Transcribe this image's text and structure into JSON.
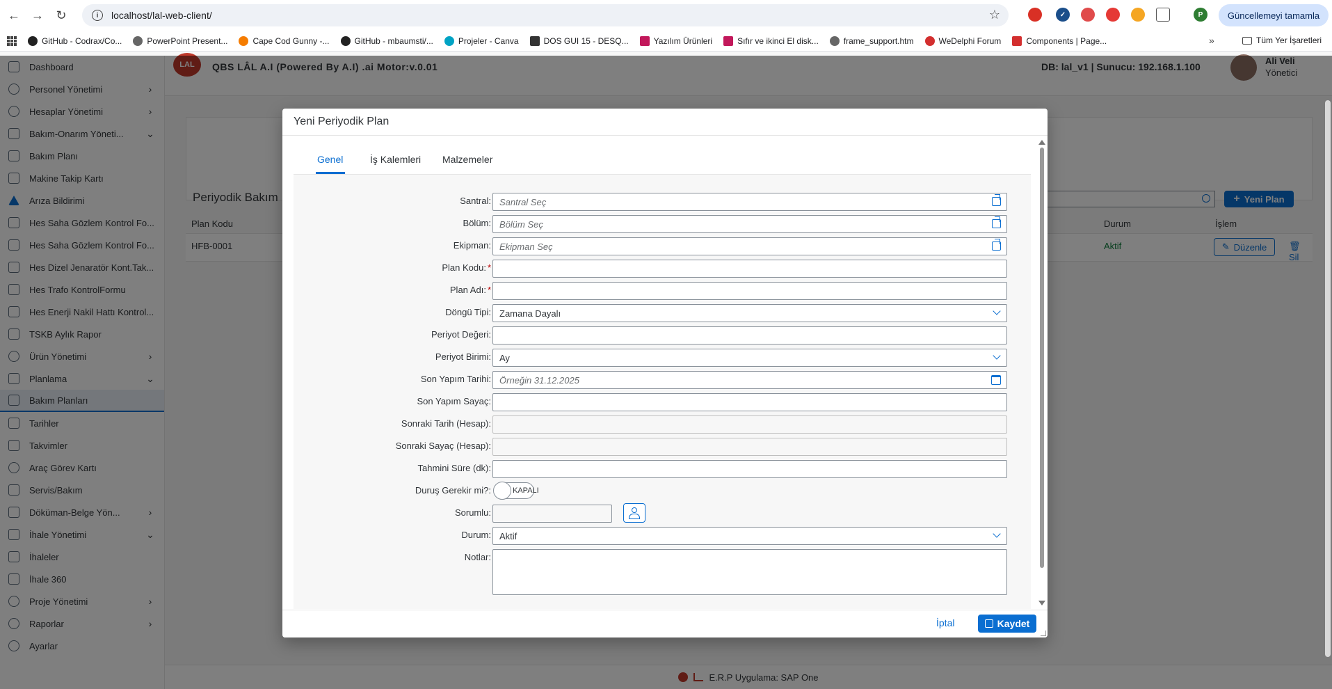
{
  "browser": {
    "url": "localhost/lal-web-client/",
    "update_button": "Güncellemeyi tamamla",
    "bookmarks": [
      "GitHub - Codrax/Co...",
      "PowerPoint Present...",
      "Cape Cod Gunny -...",
      "GitHub - mbaumsti/...",
      "Projeler - Canva",
      "DOS GUI 15 - DESQ...",
      "Yazılım Ürünleri",
      "Sıfır ve ikinci El disk...",
      "frame_support.htm",
      "WeDelphi Forum",
      "Components | Page..."
    ],
    "all_bookmarks": "Tüm Yer İşaretleri"
  },
  "app": {
    "title": "QBS LÂL A.I (Powered By A.I) .ai Motor:v.0.01",
    "logo_text": "LAL",
    "db_info": "DB: lal_v1 | Sunucu: 192.168.1.100",
    "user_name": "Ali Veli",
    "user_role": "Yönetici",
    "footer": "E.R.P Uygulama: SAP One"
  },
  "sidebar": {
    "items": [
      {
        "label": "Dashboard"
      },
      {
        "label": "Personel Yönetimi"
      },
      {
        "label": "Hesaplar Yönetimi"
      },
      {
        "label": "Bakım-Onarım Yöneti..."
      },
      {
        "label": "Bakım Planı"
      },
      {
        "label": "Makine Takip Kartı"
      },
      {
        "label": "Arıza Bildirimi"
      },
      {
        "label": "Hes Saha Gözlem Kontrol Fo..."
      },
      {
        "label": "Hes Saha Gözlem Kontrol Fo..."
      },
      {
        "label": "Hes Dizel Jenaratör Kont.Tak..."
      },
      {
        "label": "Hes Trafo KontrolFormu"
      },
      {
        "label": "Hes Enerji Nakil Hattı Kontrol..."
      },
      {
        "label": "TSKB Aylık Rapor"
      },
      {
        "label": "Ürün Yönetimi"
      },
      {
        "label": "Planlama"
      },
      {
        "label": "Bakım Planları"
      },
      {
        "label": "Tarihler"
      },
      {
        "label": "Takvimler"
      },
      {
        "label": "Araç Görev Kartı"
      },
      {
        "label": "Servis/Bakım"
      },
      {
        "label": "Döküman-Belge Yön..."
      },
      {
        "label": "İhale Yönetimi"
      },
      {
        "label": "İhaleler"
      },
      {
        "label": "İhale 360"
      },
      {
        "label": "Proje Yönetimi"
      },
      {
        "label": "Raporlar"
      },
      {
        "label": "Ayarlar"
      }
    ]
  },
  "page": {
    "title": "Periyodik Bakım",
    "new_button": "Yeni Plan",
    "columns": {
      "code": "Plan Kodu",
      "status": "Durum",
      "action": "İşlem"
    },
    "row": {
      "code": "HFB-0001",
      "status": "Aktif",
      "edit": "Düzenle",
      "delete": "Sil"
    }
  },
  "dialog": {
    "title": "Yeni Periyodik Plan",
    "tabs": [
      "Genel",
      "İş Kalemleri",
      "Malzemeler"
    ],
    "fields": {
      "santral": {
        "label": "Santral:",
        "placeholder": "Santral Seç"
      },
      "bolum": {
        "label": "Bölüm:",
        "placeholder": "Bölüm Seç"
      },
      "ekipman": {
        "label": "Ekipman:",
        "placeholder": "Ekipman Seç"
      },
      "plan_kodu": {
        "label": "Plan Kodu:",
        "value": ""
      },
      "plan_adi": {
        "label": "Plan Adı:",
        "value": ""
      },
      "dongu_tipi": {
        "label": "Döngü Tipi:",
        "value": "Zamana Dayalı"
      },
      "periyot_degeri": {
        "label": "Periyot Değeri:",
        "value": ""
      },
      "periyot_birimi": {
        "label": "Periyot Birimi:",
        "value": "Ay"
      },
      "son_yapim_tarihi": {
        "label": "Son Yapım Tarihi:",
        "placeholder": "Örneğin 31.12.2025"
      },
      "son_yapim_sayac": {
        "label": "Son Yapım Sayaç:",
        "value": ""
      },
      "sonraki_tarih": {
        "label": "Sonraki Tarih (Hesap):",
        "value": ""
      },
      "sonraki_sayac": {
        "label": "Sonraki Sayaç (Hesap):",
        "value": ""
      },
      "tahmini_sure": {
        "label": "Tahmini Süre (dk):",
        "value": ""
      },
      "durus": {
        "label": "Duruş Gerekir mi?:",
        "switch_text": "KAPALI"
      },
      "sorumlu": {
        "label": "Sorumlu:",
        "value": ""
      },
      "durum": {
        "label": "Durum:",
        "value": "Aktif"
      },
      "notlar": {
        "label": "Notlar:",
        "value": ""
      }
    },
    "cancel": "İptal",
    "save": "Kaydet"
  }
}
